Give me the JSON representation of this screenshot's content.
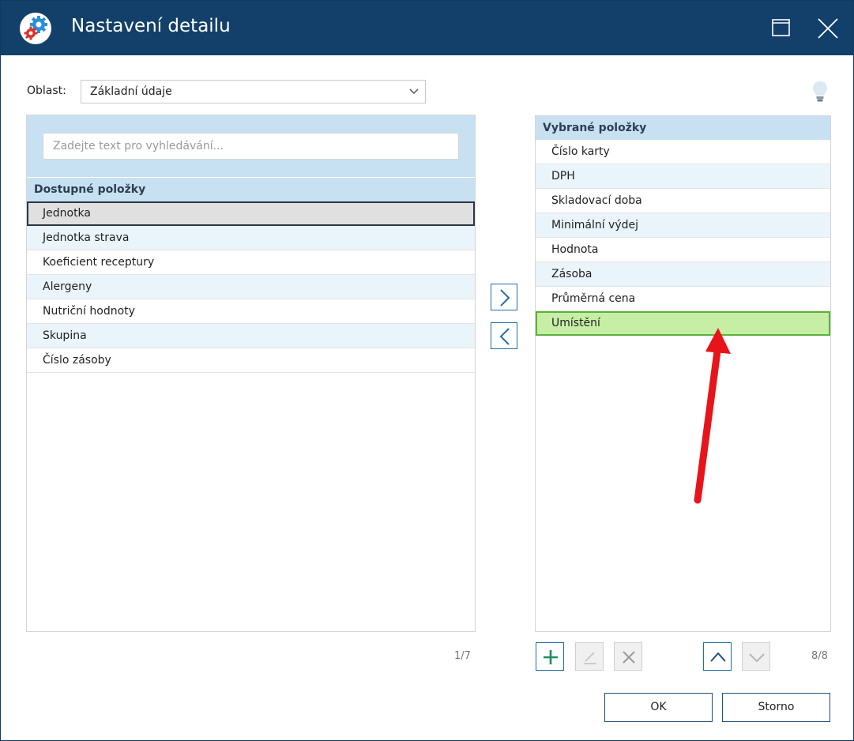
{
  "window": {
    "title": "Nastavení detailu",
    "logo_icon": "gears-icon",
    "maximize_icon": "maximize-icon",
    "close_icon": "close-icon"
  },
  "area": {
    "label": "Oblast:",
    "selected": "Základní údaje",
    "dropdown_icon": "chevron-down-icon"
  },
  "hint_icon": "lightbulb-icon",
  "available": {
    "search_placeholder": "Zadejte text pro vyhledávání...",
    "header": "Dostupné položky",
    "items": [
      {
        "label": "Jednotka",
        "selected": true
      },
      {
        "label": "Jednotka strava"
      },
      {
        "label": "Koeficient receptury"
      },
      {
        "label": "Alergeny"
      },
      {
        "label": "Nutriční hodnoty"
      },
      {
        "label": "Skupina"
      },
      {
        "label": "Číslo zásoby"
      }
    ],
    "counter": "1/7"
  },
  "selected_list": {
    "header": "Vybrané položky",
    "items": [
      {
        "label": "Číslo karty"
      },
      {
        "label": "DPH"
      },
      {
        "label": "Skladovací doba"
      },
      {
        "label": "Minimální výdej"
      },
      {
        "label": "Hodnota"
      },
      {
        "label": "Zásoba"
      },
      {
        "label": "Průměrná cena"
      },
      {
        "label": "Umístění",
        "selected": true
      }
    ],
    "counter": "8/8"
  },
  "buttons": {
    "ok": "OK",
    "cancel": "Storno"
  },
  "colors": {
    "titlebar": "#12406a",
    "accent": "#1f6ea8",
    "list_header": "#c7e1f2",
    "selection_green": "#c6eea5",
    "annotation_arrow": "#e8141b"
  }
}
